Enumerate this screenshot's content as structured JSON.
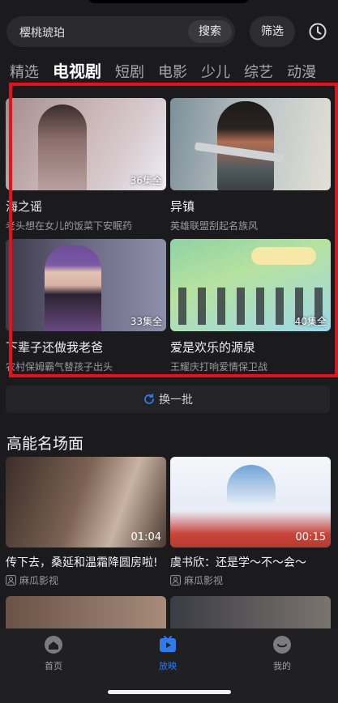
{
  "search": {
    "query": "樱桃琥珀",
    "search_label": "搜索",
    "filter_label": "筛选"
  },
  "tabs": [
    {
      "label": "精选",
      "active": false
    },
    {
      "label": "电视剧",
      "active": true
    },
    {
      "label": "短剧",
      "active": false
    },
    {
      "label": "电影",
      "active": false
    },
    {
      "label": "少儿",
      "active": false
    },
    {
      "label": "综艺",
      "active": false
    },
    {
      "label": "动漫",
      "active": false
    }
  ],
  "shows": [
    {
      "title": "海之谣",
      "subtitle": "老头想在女儿的饭菜下安眠药",
      "badge": "36集全"
    },
    {
      "title": "异镇",
      "subtitle": "英雄联盟刮起名族风",
      "badge": ""
    },
    {
      "title": "下辈子还做我老爸",
      "subtitle": "农村保姆霸气替孩子出头",
      "badge": "33集全"
    },
    {
      "title": "爱是欢乐的源泉",
      "subtitle": "王耀庆打响爱情保卫战",
      "badge": "40集全"
    }
  ],
  "refresh_label": "换一批",
  "section": {
    "title": "高能名场面"
  },
  "scenes": [
    {
      "title": "传下去，桑延和温霜降圆房啦!",
      "source": "麻瓜影视",
      "duration": "01:04"
    },
    {
      "title": "虞书欣：还是学～不～会～",
      "source": "麻瓜影视",
      "duration": "00:15"
    }
  ],
  "nav": [
    {
      "label": "首页",
      "active": false
    },
    {
      "label": "放映",
      "active": true
    },
    {
      "label": "我的",
      "active": false
    }
  ],
  "colors": {
    "accent": "#2f7bea",
    "highlight_frame": "#e8101a",
    "background": "#1b1b1d"
  }
}
